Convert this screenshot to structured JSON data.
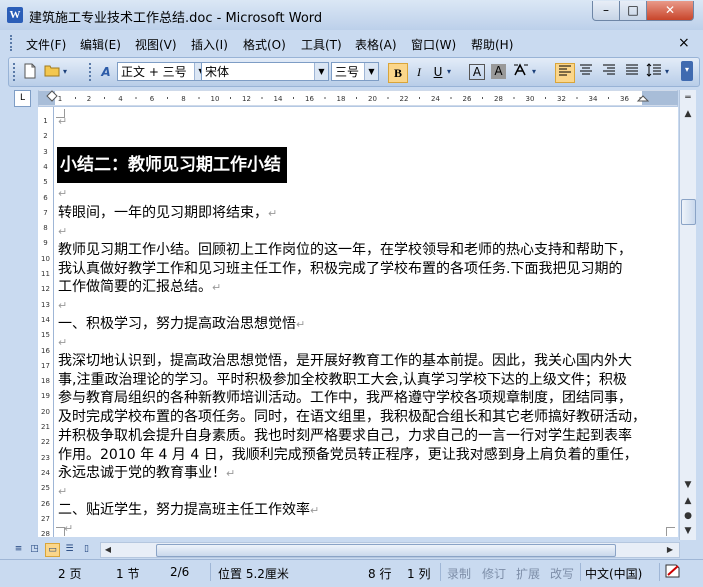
{
  "window": {
    "title": "建筑施工专业技术工作总结.doc - Microsoft Word",
    "min_label": "–",
    "max_label": "□",
    "close_label": "✕"
  },
  "menu": {
    "items": [
      "文件(F)",
      "编辑(E)",
      "视图(V)",
      "插入(I)",
      "格式(O)",
      "工具(T)",
      "表格(A)",
      "窗口(W)",
      "帮助(H)"
    ],
    "close_label": "×"
  },
  "toolbar": {
    "style_value": "正文 + 三号",
    "font_value": "宋体",
    "size_value": "三号",
    "bold_label": "B",
    "italic_label": "I",
    "underline_label": "U",
    "char_border_label": "A",
    "char_shading_label": "A"
  },
  "ruler": {
    "ticks": [
      "1",
      "2",
      "4",
      "6",
      "8",
      "10",
      "12",
      "14",
      "16",
      "18",
      "20",
      "22",
      "24",
      "26",
      "28",
      "30",
      "32",
      "34",
      "36"
    ],
    "vticks": [
      "1",
      "2",
      "3",
      "4",
      "5",
      "6",
      "7",
      "8",
      "9",
      "10",
      "11",
      "12",
      "13",
      "14",
      "15",
      "16",
      "17",
      "18",
      "19",
      "20",
      "21",
      "22",
      "23",
      "24",
      "25",
      "26",
      "27",
      "28"
    ]
  },
  "document": {
    "heading": "小结二：教师见习期工作小结",
    "para1": "转眼间，一年的见习期即将结束，",
    "para2": [
      "教师见习期工作小结。回顾初上工作岗位的这一年，在学校领导和老师的热心支持和帮助下，",
      "我认真做好教学工作和见习班主任工作，积极完成了学校布置的各项任务.下面我把见习期的",
      "工作做简要的汇报总结。"
    ],
    "section1": "一、积极学习，努力提高政治思想觉悟",
    "para3": [
      "我深切地认识到，提高政治思想觉悟，是开展好教育工作的基本前提。因此，我关心国内外大",
      "事,注重政治理论的学习。平时积极参加全校教职工大会,认真学习学校下达的上级文件；积极",
      "参与教育局组织的各种新教师培训活动。工作中，我严格遵守学校各项规章制度，团结同事，",
      "及时完成学校布置的各项任务。同时，在语文组里，我积极配合组长和其它老师搞好教研活动，",
      "并积极争取机会提升自身素质。我也时刻严格要求自己，力求自己的一言一行对学生起到表率",
      "作用。2010 年 4 月 4 日，我顺利完成预备党员转正程序，更让我对感到身上肩负着的重任，",
      "永远忠诚于党的教育事业！"
    ],
    "section2": "二、贴近学生，努力提高班主任工作效率"
  },
  "status": {
    "page": "2 页",
    "section": "1 节",
    "page_of": "2/6",
    "position": "位置 5.2厘米",
    "line": "8 行",
    "column": "1 列",
    "rec": "录制",
    "trk": "修订",
    "ext": "扩展",
    "ovr": "改写",
    "language": "中文(中国)"
  }
}
